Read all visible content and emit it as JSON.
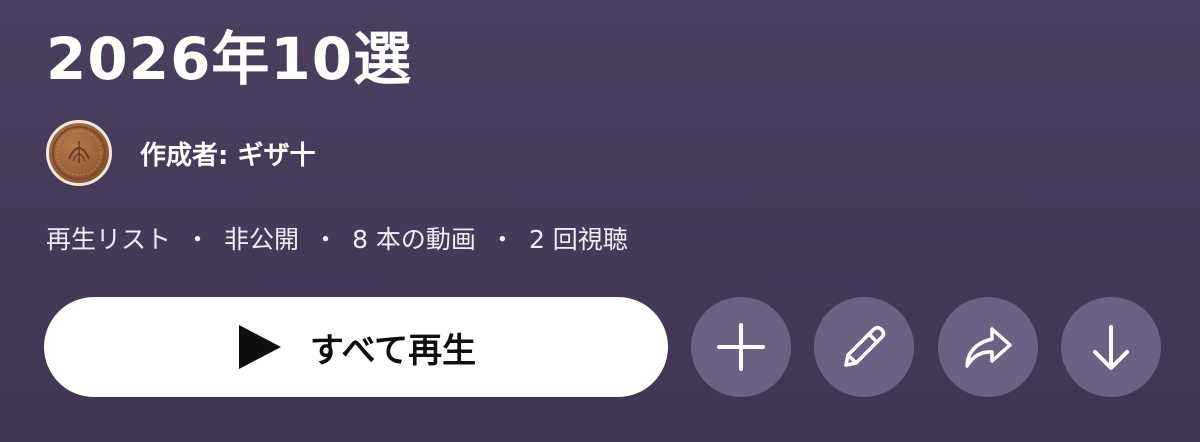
{
  "playlist": {
    "title": "2026年10選",
    "owner_label": "作成者: ギザ十",
    "meta": {
      "type": "再生リスト",
      "visibility": "非公開",
      "video_count": "8 本の動画",
      "views": "2 回視聴",
      "separator": "・"
    }
  },
  "actions": {
    "play_all_label": "すべて再生",
    "play_icon": "play-icon",
    "add_icon": "plus-icon",
    "edit_icon": "pencil-icon",
    "share_icon": "share-arrow-icon",
    "download_icon": "download-arrow-icon"
  },
  "colors": {
    "background": "#463b59",
    "primary_button": "#ffffff",
    "icon_button": "#6c6183",
    "avatar": "#98603a"
  }
}
